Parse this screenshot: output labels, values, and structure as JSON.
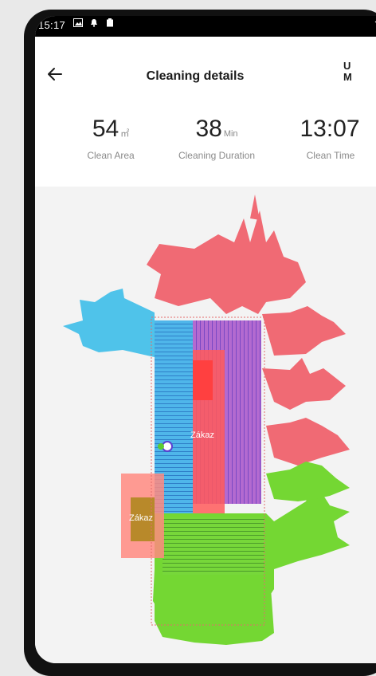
{
  "status_bar": {
    "time": "15:17"
  },
  "header": {
    "back_icon": "arrow-left-icon",
    "title": "Cleaning details",
    "right_text": "U\nM"
  },
  "stats": [
    {
      "value": "54",
      "unit": "㎡",
      "label": "Clean Area"
    },
    {
      "value": "38",
      "unit": "Min",
      "label": "Cleaning Duration"
    },
    {
      "value": "13:07",
      "unit": "",
      "label": "Clean Time"
    }
  ],
  "map": {
    "zones": [
      {
        "label": "Zákaz"
      },
      {
        "label": "Zákaz"
      }
    ],
    "colors": {
      "blue_room": "#4fc3ea",
      "pink_room": "#f06a74",
      "green_room": "#74d733",
      "purple_room": "#b06ad6",
      "nogo_zone": "#ff4040",
      "background": "#f3f3f3"
    }
  }
}
